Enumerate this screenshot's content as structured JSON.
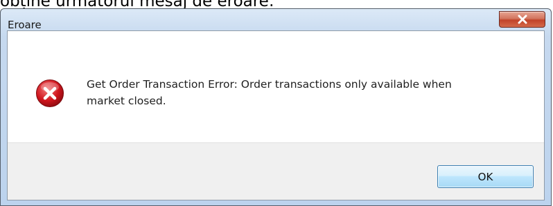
{
  "caption": "obține următorul mesaj de eroare:",
  "dialog": {
    "title": "Eroare",
    "close_glyph": "x",
    "icon": "error-icon",
    "message_line1": "Get Order Transaction Error: Order transactions only available when",
    "message_line2": "market closed.",
    "ok_label": "OK"
  },
  "colors": {
    "title_bar": "#c6d9ef",
    "close_button": "#c1432a",
    "error_icon": "#c8102e",
    "ok_button_border": "#3c7fb1"
  }
}
